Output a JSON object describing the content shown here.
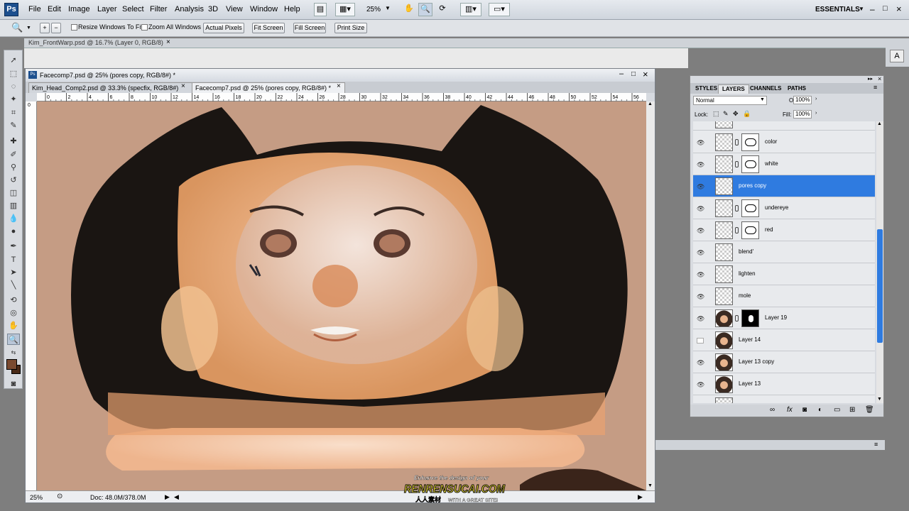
{
  "menubar": {
    "logo": "Ps",
    "items": [
      "File",
      "Edit",
      "Image",
      "Layer",
      "Select",
      "Filter",
      "Analysis",
      "3D",
      "View",
      "Window",
      "Help"
    ],
    "zoom": "25%",
    "workspace": "ESSENTIALS"
  },
  "options": {
    "resize_windows": "Resize Windows To Fit",
    "zoom_all": "Zoom All Windows",
    "actual_pixels": "Actual Pixels",
    "fit_screen": "Fit Screen",
    "fill_screen": "Fill Screen",
    "print_size": "Print Size"
  },
  "back_document": {
    "title": "Kim_FrontWarp.psd @ 16.7% (Layer 0, RGB/8)"
  },
  "document": {
    "title": "Facecomp7.psd @ 25% (pores copy, RGB/8#) *",
    "tabs": [
      {
        "label": "Kim_Head_Comp2.psd @ 33.3% (specfix, RGB/8#)"
      },
      {
        "label": "Facecomp7.psd @ 25% (pores copy, RGB/8#) *"
      }
    ],
    "zoom": "25%",
    "doc_size": "Doc: 48.0M/378.0M",
    "ruler_ticks": [
      "0",
      "2",
      "4",
      "6",
      "8",
      "10",
      "12",
      "14",
      "16",
      "18",
      "20",
      "22",
      "24",
      "26",
      "28",
      "30",
      "32",
      "34",
      "36",
      "38",
      "40",
      "42",
      "44",
      "46",
      "48",
      "50",
      "52",
      "54",
      "56"
    ]
  },
  "panel": {
    "tabs": [
      "STYLES",
      "LAYERS",
      "CHANNELS",
      "PATHS"
    ],
    "blend_mode": "Normal",
    "opacity_label": "Opacity:",
    "opacity": "100%",
    "lock_label": "Lock:",
    "fill_label": "Fill:",
    "fill": "100%",
    "layers": [
      {
        "name": "color",
        "visible": true,
        "mask": true,
        "selected": false
      },
      {
        "name": "white",
        "visible": true,
        "mask": true,
        "selected": false
      },
      {
        "name": "pores copy",
        "visible": true,
        "mask": false,
        "selected": true
      },
      {
        "name": "undereye",
        "visible": true,
        "mask": true,
        "selected": false
      },
      {
        "name": "red",
        "visible": true,
        "mask": true,
        "selected": false
      },
      {
        "name": "blend'",
        "visible": true,
        "mask": false,
        "selected": false
      },
      {
        "name": "lighten",
        "visible": true,
        "mask": false,
        "selected": false
      },
      {
        "name": "mole",
        "visible": true,
        "mask": false,
        "selected": false
      },
      {
        "name": "Layer 19",
        "visible": true,
        "mask": true,
        "selected": false
      },
      {
        "name": "Layer 14",
        "visible": false,
        "mask": false,
        "selected": false
      },
      {
        "name": "Layer 13 copy",
        "visible": true,
        "mask": false,
        "selected": false
      },
      {
        "name": "Layer 13",
        "visible": true,
        "mask": false,
        "selected": false
      }
    ]
  },
  "watermark": {
    "line1": "Enhance the design of your",
    "brand": "RENRENSUCAI.COM",
    "line2": "人人素材",
    "line3": "WITH A GREAT SITE!"
  },
  "colors": {
    "selection": "#2f7be0",
    "skin": "#c59c84",
    "hair": "#1a1512",
    "foreground": "#7a4a30",
    "background": "#4a2a18"
  }
}
